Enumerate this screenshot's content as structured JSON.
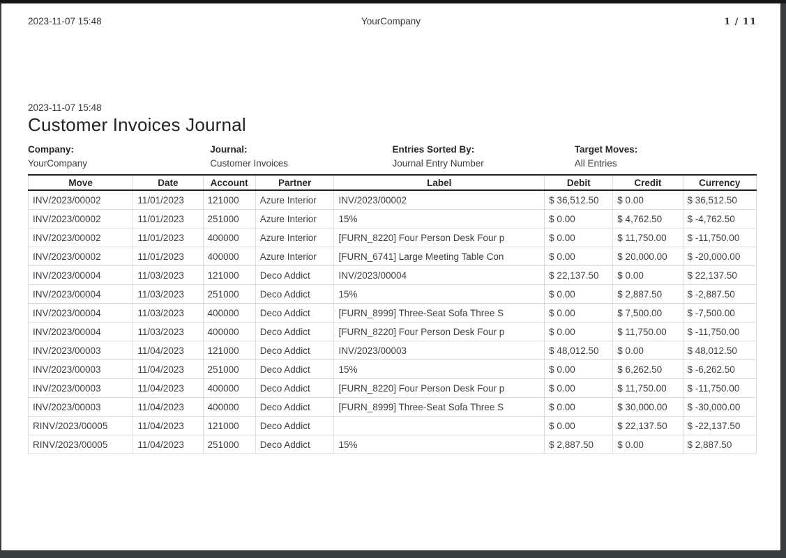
{
  "run_header": {
    "datetime": "2023-11-07 15:48",
    "company": "YourCompany",
    "page_indicator": "1 / 11"
  },
  "report": {
    "datetime": "2023-11-07 15:48",
    "title": "Customer Invoices Journal",
    "meta": [
      {
        "label": "Company:",
        "value": "YourCompany"
      },
      {
        "label": "Journal:",
        "value": "Customer Invoices"
      },
      {
        "label": "Entries Sorted By:",
        "value": "Journal Entry Number"
      },
      {
        "label": "Target Moves:",
        "value": "All Entries"
      }
    ]
  },
  "table": {
    "columns": [
      "Move",
      "Date",
      "Account",
      "Partner",
      "Label",
      "Debit",
      "Credit",
      "Currency"
    ],
    "rows": [
      [
        "INV/2023/00002",
        "11/01/2023",
        "121000",
        "Azure Interior",
        "INV/2023/00002",
        "$ 36,512.50",
        "$ 0.00",
        "$ 36,512.50"
      ],
      [
        "INV/2023/00002",
        "11/01/2023",
        "251000",
        "Azure Interior",
        "15%",
        "$ 0.00",
        "$ 4,762.50",
        "$ -4,762.50"
      ],
      [
        "INV/2023/00002",
        "11/01/2023",
        "400000",
        "Azure Interior",
        "[FURN_8220] Four Person Desk Four p",
        "$ 0.00",
        "$ 11,750.00",
        "$ -11,750.00"
      ],
      [
        "INV/2023/00002",
        "11/01/2023",
        "400000",
        "Azure Interior",
        "[FURN_6741] Large Meeting Table Con",
        "$ 0.00",
        "$ 20,000.00",
        "$ -20,000.00"
      ],
      [
        "INV/2023/00004",
        "11/03/2023",
        "121000",
        "Deco Addict",
        "INV/2023/00004",
        "$ 22,137.50",
        "$ 0.00",
        "$ 22,137.50"
      ],
      [
        "INV/2023/00004",
        "11/03/2023",
        "251000",
        "Deco Addict",
        "15%",
        "$ 0.00",
        "$ 2,887.50",
        "$ -2,887.50"
      ],
      [
        "INV/2023/00004",
        "11/03/2023",
        "400000",
        "Deco Addict",
        "[FURN_8999] Three-Seat Sofa Three S",
        "$ 0.00",
        "$ 7,500.00",
        "$ -7,500.00"
      ],
      [
        "INV/2023/00004",
        "11/03/2023",
        "400000",
        "Deco Addict",
        "[FURN_8220] Four Person Desk Four p",
        "$ 0.00",
        "$ 11,750.00",
        "$ -11,750.00"
      ],
      [
        "INV/2023/00003",
        "11/04/2023",
        "121000",
        "Deco Addict",
        "INV/2023/00003",
        "$ 48,012.50",
        "$ 0.00",
        "$ 48,012.50"
      ],
      [
        "INV/2023/00003",
        "11/04/2023",
        "251000",
        "Deco Addict",
        "15%",
        "$ 0.00",
        "$ 6,262.50",
        "$ -6,262.50"
      ],
      [
        "INV/2023/00003",
        "11/04/2023",
        "400000",
        "Deco Addict",
        "[FURN_8220] Four Person Desk Four p",
        "$ 0.00",
        "$ 11,750.00",
        "$ -11,750.00"
      ],
      [
        "INV/2023/00003",
        "11/04/2023",
        "400000",
        "Deco Addict",
        "[FURN_8999] Three-Seat Sofa Three S",
        "$ 0.00",
        "$ 30,000.00",
        "$ -30,000.00"
      ],
      [
        "RINV/2023/00005",
        "11/04/2023",
        "121000",
        "Deco Addict",
        "",
        "$ 0.00",
        "$ 22,137.50",
        "$ -22,137.50"
      ],
      [
        "RINV/2023/00005",
        "11/04/2023",
        "251000",
        "Deco Addict",
        "15%",
        "$ 2,887.50",
        "$ 0.00",
        "$ 2,887.50"
      ]
    ]
  },
  "colors": {
    "page_background": "#ffffff",
    "frame_background": "#383c3f",
    "text": "#3b3e42",
    "table_header_border": "#1c1e21",
    "table_cell_border": "#d9dcd9"
  }
}
